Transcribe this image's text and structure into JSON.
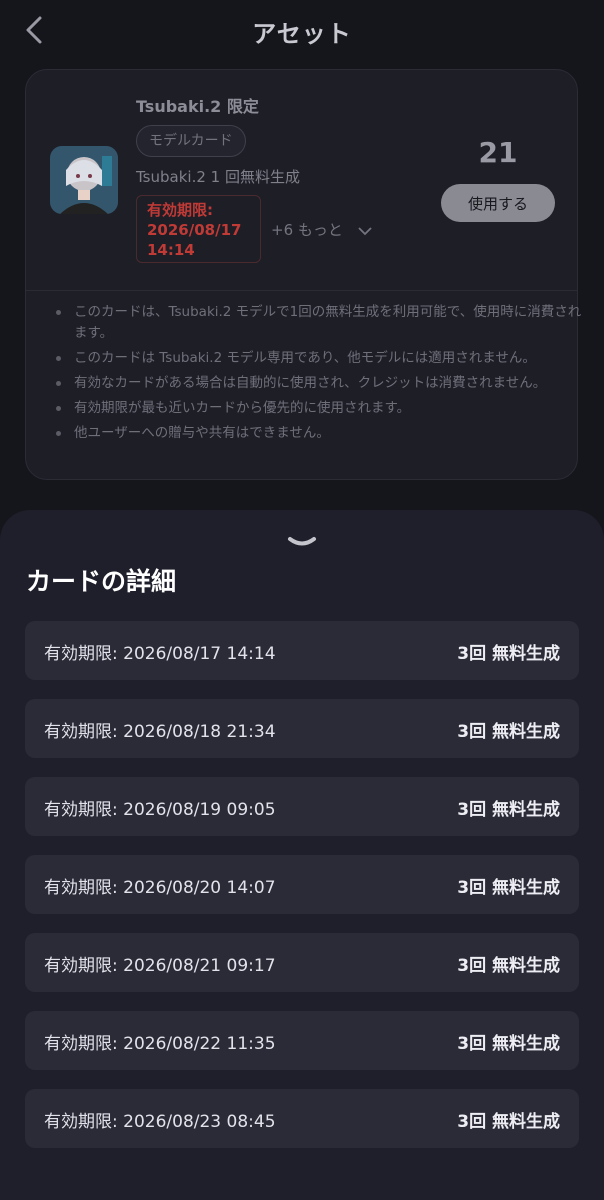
{
  "header": {
    "title": "アセット"
  },
  "card": {
    "title": "Tsubaki.2 限定",
    "type_label": "モデルカード",
    "description": "Tsubaki.2 1 回無料生成",
    "expiry_line1": "有効期限:",
    "expiry_line2": "2026/08/17",
    "expiry_line3": "14:14",
    "more_label": "+6 もっと",
    "count": "21",
    "use_button": "使用する",
    "notes": [
      "このカードは、Tsubaki.2 モデルで1回の無料生成を利用可能で、使用時に消費されます。",
      "このカードは Tsubaki.2 モデル専用であり、他モデルには適用されません。",
      "有効なカードがある場合は自動的に使用され、クレジットは消費されません。",
      "有効期限が最も近いカードから優先的に使用されます。",
      "他ユーザーへの贈与や共有はできません。"
    ]
  },
  "sheet": {
    "title": "カードの詳細",
    "rows": [
      {
        "expiry": "有効期限: 2026/08/17 14:14",
        "uses": "3回 無料生成"
      },
      {
        "expiry": "有効期限: 2026/08/18 21:34",
        "uses": "3回 無料生成"
      },
      {
        "expiry": "有効期限: 2026/08/19 09:05",
        "uses": "3回 無料生成"
      },
      {
        "expiry": "有効期限: 2026/08/20 14:07",
        "uses": "3回 無料生成"
      },
      {
        "expiry": "有効期限: 2026/08/21 09:17",
        "uses": "3回 無料生成"
      },
      {
        "expiry": "有効期限: 2026/08/22 11:35",
        "uses": "3回 無料生成"
      },
      {
        "expiry": "有効期限: 2026/08/23 08:45",
        "uses": "3回 無料生成"
      }
    ]
  },
  "colors": {
    "expiry_red": "#c03a36",
    "sheet_bg": "#1f1f2b",
    "row_bg": "#2b2b38"
  }
}
